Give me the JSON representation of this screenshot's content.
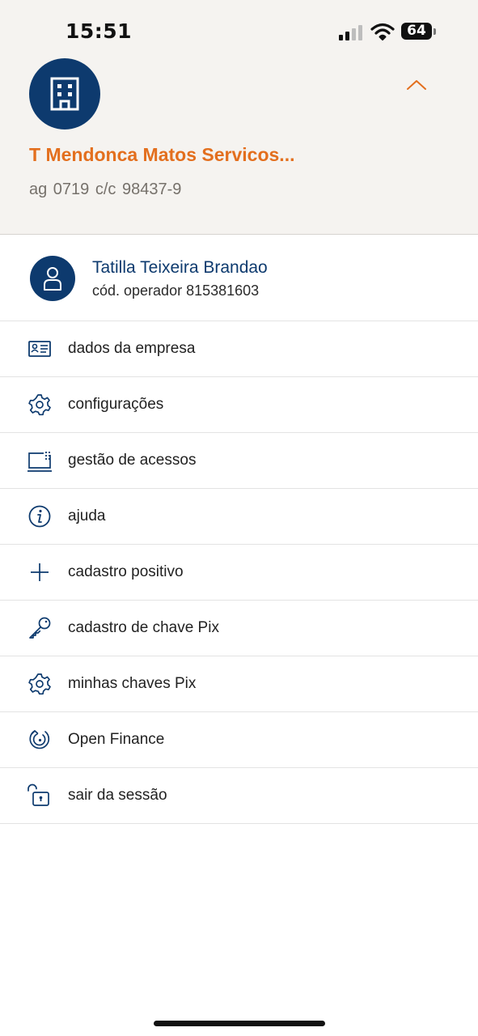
{
  "status_bar": {
    "time": "15:51",
    "battery": "64",
    "icons": [
      "cellular-signal-icon",
      "wifi-icon",
      "battery-icon"
    ]
  },
  "account": {
    "company_name": "T Mendonca Matos Servicos...",
    "account_info": "ag 0719  c/c 98437-9",
    "avatar_icon": "building-icon",
    "toggle_icon": "chevron-up-icon"
  },
  "user": {
    "name": "Tatilla Teixeira Brandao",
    "operator_code": "cód. operador 815381603",
    "avatar_icon": "person-icon"
  },
  "menu": {
    "items": [
      {
        "label": "dados da empresa",
        "icon": "id-card-icon"
      },
      {
        "label": "configurações",
        "icon": "gear-icon"
      },
      {
        "label": "gestão de acessos",
        "icon": "access-terminal-icon"
      },
      {
        "label": "ajuda",
        "icon": "info-icon"
      },
      {
        "label": "cadastro positivo",
        "icon": "plus-icon"
      },
      {
        "label": "cadastro de chave Pix",
        "icon": "key-icon"
      },
      {
        "label": "minhas chaves Pix",
        "icon": "gear-icon"
      },
      {
        "label": "Open Finance",
        "icon": "open-finance-icon"
      },
      {
        "label": "sair da sessão",
        "icon": "unlocked-padlock-icon"
      }
    ]
  },
  "colors": {
    "brand_blue": "#0d3a6e",
    "brand_orange": "#e36f1e",
    "header_background": "#f5f3f0"
  }
}
